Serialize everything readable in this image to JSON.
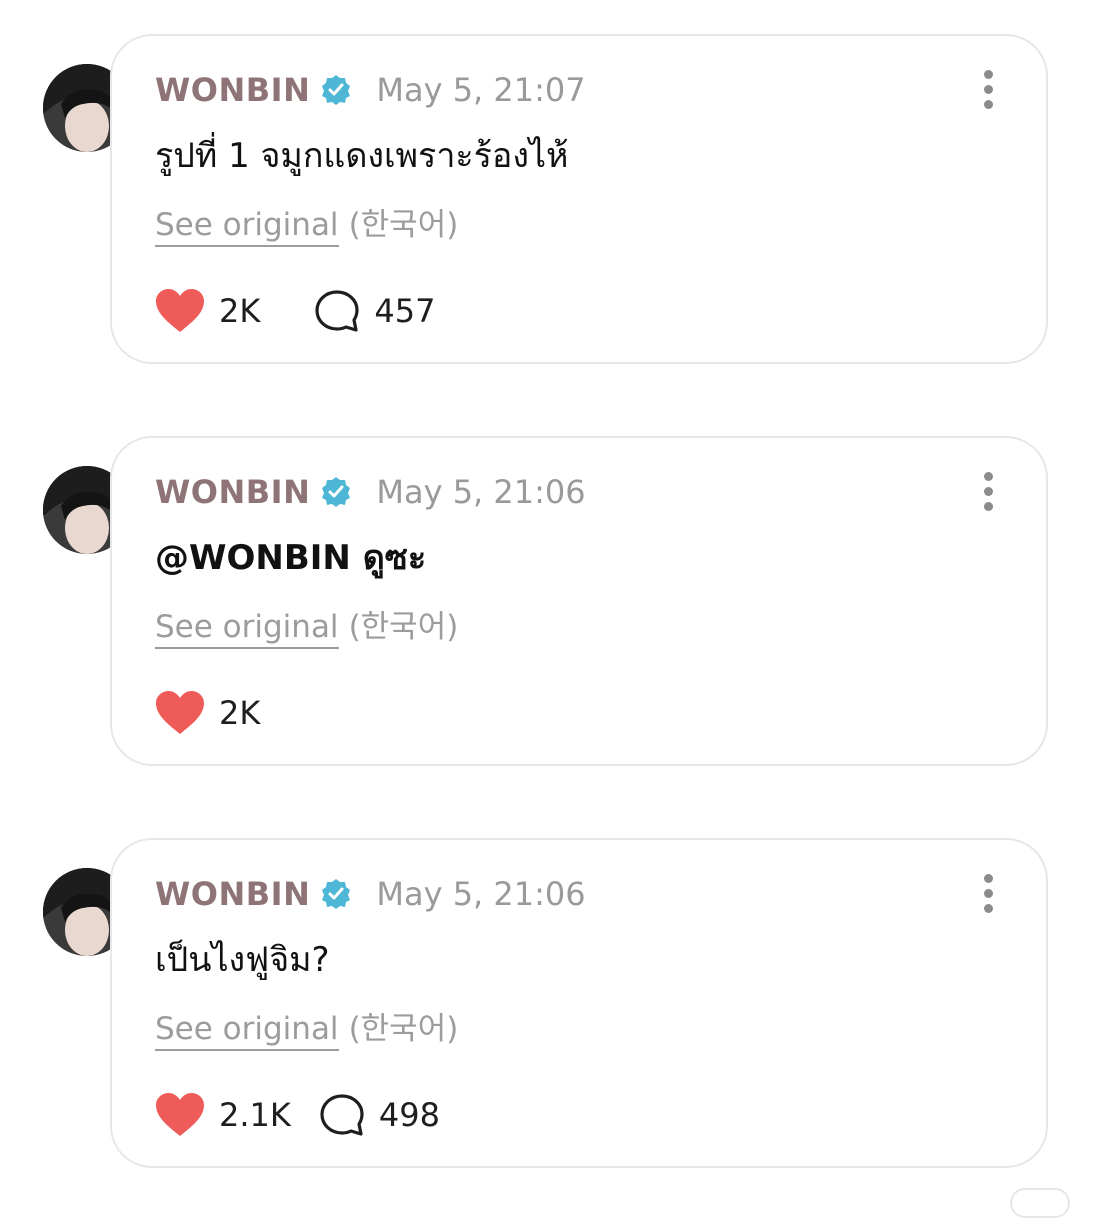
{
  "posts": [
    {
      "username": "WONBIN",
      "timestamp": "May 5, 21:07",
      "text": "รูปที่ 1 จมูกแดงเพราะร้องไห้",
      "see_original": "See original",
      "language": "(한국어)",
      "likes": "2K",
      "replies": "457"
    },
    {
      "username": "WONBIN",
      "timestamp": "May 5, 21:06",
      "text": "@WONBIN ดูซะ",
      "see_original": "See original",
      "language": "(한국어)",
      "likes": "2K",
      "replies": ""
    },
    {
      "username": "WONBIN",
      "timestamp": "May 5, 21:06",
      "text": "เป็นไงฟูจิม?",
      "see_original": "See original",
      "language": "(한국어)",
      "likes": "2.1K",
      "replies": "498"
    }
  ],
  "colors": {
    "username": "#8e7476",
    "verified": "#4fb7d6",
    "heart": "#ef5b58",
    "border": "#e7e7e7"
  },
  "icons": {
    "verified": "verified-badge-icon",
    "more": "more-vertical-icon",
    "like": "heart-icon",
    "reply": "speech-bubble-icon"
  }
}
